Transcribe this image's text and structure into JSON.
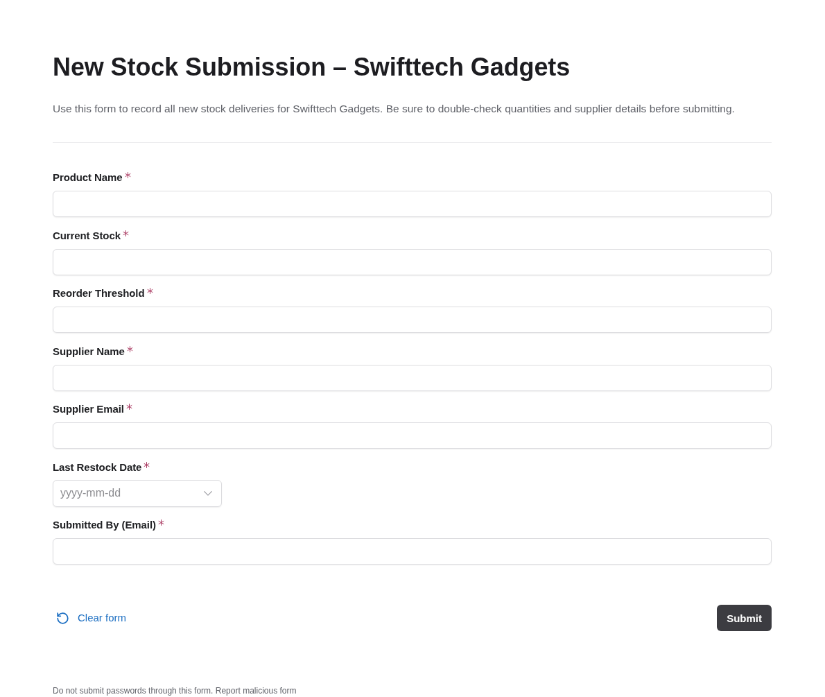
{
  "header": {
    "title": "New Stock Submission – Swifttech Gadgets",
    "description": "Use this form to record all new stock deliveries for Swifttech Gadgets. Be sure to double-check quantities and supplier details before submitting."
  },
  "fields": [
    {
      "label": "Product Name",
      "kind": "text",
      "required": true
    },
    {
      "label": "Current Stock",
      "kind": "text",
      "required": true
    },
    {
      "label": "Reorder Threshold",
      "kind": "text",
      "required": true
    },
    {
      "label": "Supplier Name",
      "kind": "text",
      "required": true
    },
    {
      "label": "Supplier Email",
      "kind": "text",
      "required": true
    },
    {
      "label": "Last Restock Date",
      "kind": "date",
      "required": true,
      "placeholder": "yyyy-mm-dd"
    },
    {
      "label": "Submitted By (Email)",
      "kind": "text",
      "required": true
    }
  ],
  "actions": {
    "clear": "Clear form",
    "submit": "Submit"
  },
  "footer": {
    "notice": "Do not submit passwords through this form.",
    "link": "Report malicious form"
  }
}
